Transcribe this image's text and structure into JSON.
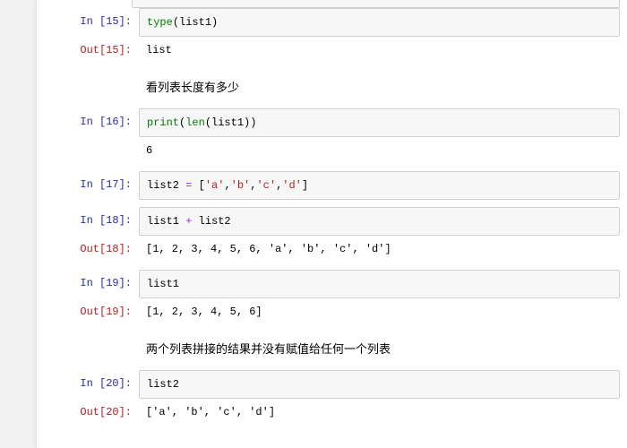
{
  "cells": [
    {
      "in_label": "In  [15]:",
      "code_html": "<span class='kw'>type</span>(list1)",
      "out_label": "Out[15]:",
      "out_text": "list"
    },
    {
      "markdown": "看列表长度有多少"
    },
    {
      "in_label": "In  [16]:",
      "code_html": "<span class='kw'>print</span>(<span class='fn'>len</span>(list1))",
      "stream": "6"
    },
    {
      "in_label": "In  [17]:",
      "code_html": "list2 <span class='op'>=</span> [<span class='str'>'a'</span>,<span class='str'>'b'</span>,<span class='str'>'c'</span>,<span class='str'>'d'</span>]"
    },
    {
      "in_label": "In  [18]:",
      "code_html": "list1 <span class='op'>+</span> list2",
      "out_label": "Out[18]:",
      "out_text": "[1, 2, 3, 4, 5, 6, 'a', 'b', 'c', 'd']"
    },
    {
      "in_label": "In  [19]:",
      "code_html": "list1",
      "out_label": "Out[19]:",
      "out_text": "[1, 2, 3, 4, 5, 6]"
    },
    {
      "markdown": "两个列表拼接的结果并没有赋值给任何一个列表"
    },
    {
      "in_label": "In  [20]:",
      "code_html": "list2",
      "out_label": "Out[20]:",
      "out_text": "['a', 'b', 'c', 'd']"
    }
  ]
}
